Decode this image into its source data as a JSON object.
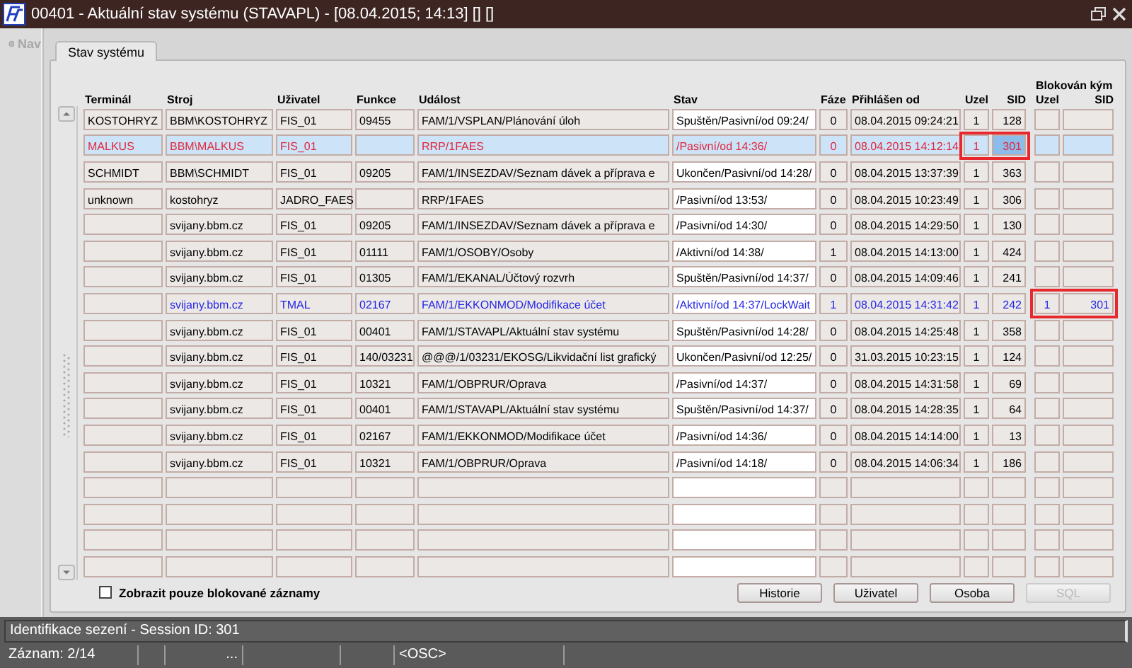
{
  "window": {
    "title": "00401 - Aktuální stav systému (STAVAPL) - [08.04.2015; 14:13] [] []"
  },
  "nav": {
    "label": "Nav",
    "disabled": true
  },
  "tabs": [
    {
      "label": "Stav systému",
      "selected": true
    }
  ],
  "table": {
    "columns": [
      "Terminál",
      "Stroj",
      "Uživatel",
      "Funkce",
      "Událost",
      "Stav",
      "Fáze",
      "Přihlášen od",
      "Uzel",
      "SID"
    ],
    "blocked_by": {
      "title": "Blokován kým",
      "columns": [
        "Uzel",
        "SID"
      ]
    },
    "rows": [
      {
        "terminal": "KOSTOHRYZ",
        "machine": "BBM\\KOSTOHRYZ",
        "user": "FIS_01",
        "function": "09455",
        "event": "FAM/1/VSPLAN/Plánování úloh",
        "state": "Spuštěn/Pasivní/od 09:24/",
        "phase": "0",
        "login": "08.04.2015 09:24:21",
        "node": "1",
        "sid": "128",
        "color": "#000000",
        "selected": false,
        "session_framed": false,
        "blocker_framed": false
      },
      {
        "terminal": "MALKUS",
        "machine": "BBM\\MALKUS",
        "user": "FIS_01",
        "event": "RRP/1FAES",
        "state": "/Pasivní/od 14:36/",
        "phase": "0",
        "login": "08.04.2015 14:12:14",
        "node": "1",
        "sid": "301",
        "color": "#e0283c",
        "selected": true,
        "session_framed": true,
        "blocker_framed": false
      },
      {
        "terminal": "SCHMIDT",
        "machine": "BBM\\SCHMIDT",
        "user": "FIS_01",
        "function": "09205",
        "event": "FAM/1/INSEZDAV/Seznam dávek a příprava e",
        "state": "Ukončen/Pasivní/od 14:28/",
        "phase": "0",
        "login": "08.04.2015 13:37:39",
        "node": "1",
        "sid": "363",
        "color": "#000000",
        "selected": false,
        "session_framed": false,
        "blocker_framed": false
      },
      {
        "terminal": "unknown",
        "machine": "kostohryz",
        "user": "JADRO_FAES",
        "event": "RRP/1FAES",
        "state": "/Pasivní/od 13:53/",
        "phase": "0",
        "login": "08.04.2015 10:23:49",
        "node": "1",
        "sid": "306",
        "color": "#000000",
        "selected": false,
        "session_framed": false,
        "blocker_framed": false
      },
      {
        "machine": "svijany.bbm.cz",
        "user": "FIS_01",
        "function": "09205",
        "event": "FAM/1/INSEZDAV/Seznam dávek a příprava e",
        "state": "/Pasivní/od 14:30/",
        "phase": "0",
        "login": "08.04.2015 14:29:50",
        "node": "1",
        "sid": "130",
        "color": "#000000",
        "selected": false,
        "session_framed": false,
        "blocker_framed": false
      },
      {
        "machine": "svijany.bbm.cz",
        "user": "FIS_01",
        "function": "01111",
        "event": "FAM/1/OSOBY/Osoby",
        "state": "/Aktivní/od 14:38/",
        "phase": "1",
        "login": "08.04.2015 14:13:00",
        "node": "1",
        "sid": "424",
        "color": "#000000",
        "selected": false,
        "session_framed": false,
        "blocker_framed": false
      },
      {
        "machine": "svijany.bbm.cz",
        "user": "FIS_01",
        "function": "01305",
        "event": "FAM/1/EKANAL/Účtový rozvrh",
        "state": "Spuštěn/Pasivní/od 14:37/",
        "phase": "0",
        "login": "08.04.2015 14:09:46",
        "node": "1",
        "sid": "241",
        "color": "#000000",
        "selected": false,
        "session_framed": false,
        "blocker_framed": false
      },
      {
        "machine": "svijany.bbm.cz",
        "user": "TMAL",
        "function": "02167",
        "event": "FAM/1/EKKONMOD/Modifikace účet",
        "state": "/Aktivní/od 14:37/LockWait",
        "phase": "1",
        "login": "08.04.2015 14:31:42",
        "node": "1",
        "sid": "242",
        "blocked_node": "1",
        "blocked_sid": "301",
        "color": "#2626e6",
        "selected": false,
        "session_framed": false,
        "blocker_framed": true
      },
      {
        "machine": "svijany.bbm.cz",
        "user": "FIS_01",
        "function": "00401",
        "event": "FAM/1/STAVAPL/Aktuální stav systému",
        "state": "Spuštěn/Pasivní/od 14:28/",
        "phase": "0",
        "login": "08.04.2015 14:25:48",
        "node": "1",
        "sid": "358",
        "color": "#000000",
        "selected": false,
        "session_framed": false,
        "blocker_framed": false
      },
      {
        "machine": "svijany.bbm.cz",
        "user": "FIS_01",
        "function": "140/03231",
        "event": "@@@/1/03231/EKOSG/Likvidační list grafický",
        "state": "Ukončen/Pasivní/od 12:25/",
        "phase": "0",
        "login": "31.03.2015 10:23:15",
        "node": "1",
        "sid": "124",
        "color": "#000000",
        "selected": false,
        "session_framed": false,
        "blocker_framed": false
      },
      {
        "machine": "svijany.bbm.cz",
        "user": "FIS_01",
        "function": "10321",
        "event": "FAM/1/OBPRUR/Oprava",
        "state": "/Pasivní/od 14:37/",
        "phase": "0",
        "login": "08.04.2015 14:31:58",
        "node": "1",
        "sid": "69",
        "color": "#000000",
        "selected": false,
        "session_framed": false,
        "blocker_framed": false
      },
      {
        "machine": "svijany.bbm.cz",
        "user": "FIS_01",
        "function": "00401",
        "event": "FAM/1/STAVAPL/Aktuální stav systému",
        "state": "Spuštěn/Pasivní/od 14:37/",
        "phase": "0",
        "login": "08.04.2015 14:28:35",
        "node": "1",
        "sid": "64",
        "color": "#000000",
        "selected": false,
        "session_framed": false,
        "blocker_framed": false
      },
      {
        "machine": "svijany.bbm.cz",
        "user": "FIS_01",
        "function": "02167",
        "event": "FAM/1/EKKONMOD/Modifikace účet",
        "state": "/Pasivní/od 14:36/",
        "phase": "0",
        "login": "08.04.2015 14:14:00",
        "node": "1",
        "sid": "13",
        "color": "#000000",
        "selected": false,
        "session_framed": false,
        "blocker_framed": false
      },
      {
        "machine": "svijany.bbm.cz",
        "user": "FIS_01",
        "function": "10321",
        "event": "FAM/1/OBPRUR/Oprava",
        "state": "/Pasivní/od 14:18/",
        "phase": "0",
        "login": "08.04.2015 14:06:34",
        "node": "1",
        "sid": "186",
        "color": "#000000",
        "selected": false,
        "session_framed": false,
        "blocker_framed": false
      }
    ]
  },
  "filter": {
    "label": "Zobrazit pouze blokované záznamy",
    "checked": false
  },
  "buttons": [
    {
      "label": "Historie",
      "disabled": false
    },
    {
      "label": "Uživatel",
      "disabled": false
    },
    {
      "label": "Osoba",
      "disabled": false
    },
    {
      "label": "SQL",
      "disabled": true
    }
  ],
  "status_bar": {
    "message": "Identifikace sezení - Session ID: 301",
    "record": "Záznam: 2/14",
    "field_3": "...",
    "mode": "<OSC>"
  }
}
